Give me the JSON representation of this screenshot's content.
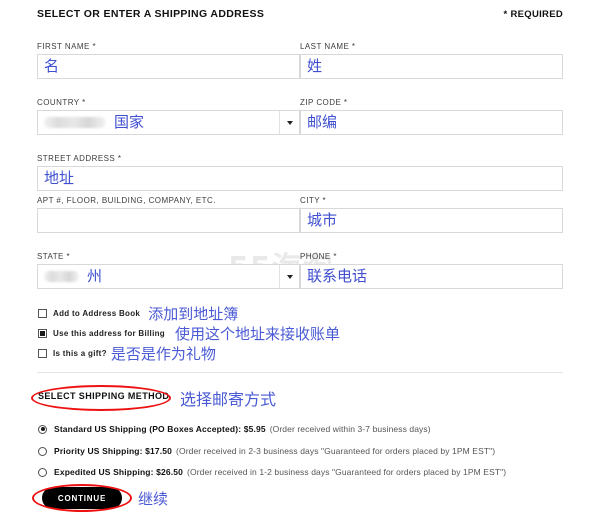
{
  "watermark": "55海淘",
  "header": {
    "title": "SELECT OR ENTER A SHIPPING ADDRESS",
    "required_note": "* REQUIRED"
  },
  "form": {
    "first_name": {
      "label": "FIRST NAME *",
      "value": "名"
    },
    "last_name": {
      "label": "LAST NAME *",
      "value": "姓"
    },
    "country": {
      "label": "COUNTRY *",
      "value": "国家",
      "redacted": true,
      "has_dropdown": true
    },
    "zip_code": {
      "label": "ZIP CODE *",
      "value": "邮编"
    },
    "street_address": {
      "label": "STREET ADDRESS *",
      "value": "地址"
    },
    "apt": {
      "label": "APT #, FLOOR, BUILDING, COMPANY, ETC.",
      "value": ""
    },
    "city": {
      "label": "CITY *",
      "value": "城市"
    },
    "state": {
      "label": "STATE *",
      "value": "州",
      "redacted": true,
      "has_dropdown": true
    },
    "phone": {
      "label": "PHONE *",
      "value": "联系电话"
    }
  },
  "checkboxes": [
    {
      "label": "Add to Address Book",
      "annotation": "添加到地址簿",
      "checked": false
    },
    {
      "label": "Use this address for Billing",
      "annotation": "使用这个地址来接收账单",
      "checked": true
    },
    {
      "label": "Is this a gift?",
      "annotation": "是否是作为礼物",
      "checked": false
    }
  ],
  "shipping": {
    "heading": "SELECT SHIPPING METHOD",
    "heading_annotation": "选择邮寄方式",
    "options": [
      {
        "name": "Standard US Shipping (PO Boxes Accepted): $5.95",
        "note": "(Order received within 3-7 business days)",
        "selected": true
      },
      {
        "name": "Priority US Shipping: $17.50",
        "note": "(Order received in 2-3 business days \"Guaranteed for orders placed by 1PM EST\")",
        "selected": false
      },
      {
        "name": "Expedited US Shipping: $26.50",
        "note": "(Order received in 1-2 business days \"Guaranteed for orders placed by 1PM EST\")",
        "selected": false
      }
    ]
  },
  "footer": {
    "continue_label": "CONTINUE",
    "continue_annotation": "继续"
  },
  "colors": {
    "annotation_blue": "#4a5ad4",
    "highlight_red": "#ee1111",
    "button_black": "#000000",
    "field_border": "#d8d8d8"
  }
}
